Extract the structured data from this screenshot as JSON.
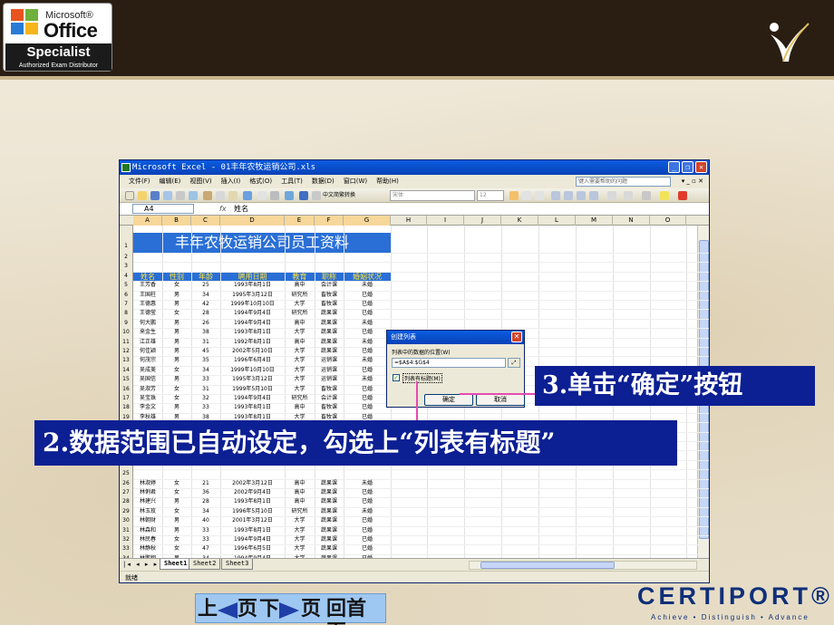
{
  "slide": {
    "logo": {
      "microsoft": "Microsoft®",
      "office": "Office",
      "specialist": "Specialist",
      "authorized": "Authorized Exam Distributor"
    },
    "certiport": {
      "name": "CERTIPORT®",
      "tagline": "Achieve • Distinguish • Advance"
    },
    "nav": {
      "prev": "上",
      "prev_suffix": "页",
      "next": "下",
      "next_suffix": "页",
      "home": "回首页"
    },
    "callout_3": "3.单击“确定”按钮",
    "callout_2": "2.数据范围已自动设定，勾选上“列表有标题”"
  },
  "excel": {
    "title": "Microsoft Excel - 01丰年农牧运销公司.xls",
    "menu": [
      "文件(F)",
      "编辑(E)",
      "视图(V)",
      "插入(I)",
      "格式(O)",
      "工具(T)",
      "数据(D)",
      "窗口(W)",
      "帮助(H)"
    ],
    "help_placeholder": "键入需要帮助的问题",
    "toolbar": {
      "convert_label": "中文简繁转换",
      "font": "宋体",
      "size": "12"
    },
    "name_box": "A4",
    "formula": "姓名",
    "columns": [
      "A",
      "B",
      "C",
      "D",
      "E",
      "F",
      "G",
      "H",
      "I",
      "J",
      "K",
      "L",
      "M",
      "N",
      "O"
    ],
    "row_numbers": [
      "1",
      "2",
      "3",
      "4",
      "5",
      "6",
      "7",
      "8",
      "9",
      "10",
      "11",
      "12",
      "13",
      "14",
      "15",
      "16",
      "17",
      "18",
      "19",
      "20",
      "21",
      "22",
      "23",
      "24",
      "25",
      "26",
      "27",
      "28",
      "29",
      "30",
      "31",
      "32",
      "33",
      "34",
      "35"
    ],
    "banner": "丰年农牧运销公司员工资料",
    "headers": [
      "姓名",
      "性别",
      "年龄",
      "聘用日期",
      "教育",
      "职称",
      "婚姻状况"
    ],
    "rows": [
      [
        "王芳香",
        "女",
        "25",
        "1993年8月1日",
        "高中",
        "会计课",
        "未婚"
      ],
      [
        "王国柱",
        "男",
        "34",
        "1995年3月12日",
        "研究所",
        "畜牧课",
        "已婚"
      ],
      [
        "王德惠",
        "男",
        "42",
        "1999年10月10日",
        "大学",
        "畜牧课",
        "已婚"
      ],
      [
        "王德莹",
        "女",
        "28",
        "1994年9月4日",
        "研究所",
        "蔬果课",
        "已婚"
      ],
      [
        "何大鹏",
        "男",
        "26",
        "1994年9月4日",
        "高中",
        "蔬果课",
        "未婚"
      ],
      [
        "来金生",
        "男",
        "38",
        "1993年8月1日",
        "大学",
        "蔬果课",
        "已婚"
      ],
      [
        "江正雄",
        "男",
        "31",
        "1992年8月1日",
        "高中",
        "蔬果课",
        "未婚"
      ],
      [
        "何佳颖",
        "男",
        "45",
        "2002年5月10日",
        "大学",
        "蔬果课",
        "已婚"
      ],
      [
        "何茂宗",
        "男",
        "35",
        "1996年6月4日",
        "大学",
        "运销课",
        "未婚"
      ],
      [
        "吴成美",
        "女",
        "34",
        "1999年10月10日",
        "大学",
        "运销课",
        "已婚"
      ],
      [
        "吴国信",
        "男",
        "33",
        "1995年3月12日",
        "大学",
        "运销课",
        "未婚"
      ],
      [
        "吴淑芳",
        "女",
        "31",
        "1999年5月10日",
        "大学",
        "畜牧课",
        "已婚"
      ],
      [
        "吴宝珠",
        "女",
        "32",
        "1994年9月4日",
        "研究所",
        "会计课",
        "已婚"
      ],
      [
        "李金文",
        "男",
        "33",
        "1993年8月1日",
        "高中",
        "畜牧课",
        "已婚"
      ],
      [
        "李秋雄",
        "男",
        "38",
        "1993年8月1日",
        "大学",
        "畜牧课",
        "已婚"
      ],
      [
        "李进禄",
        "男",
        "44",
        "1990年8月4日",
        "大学",
        "畜牧课",
        "已婚"
      ]
    ],
    "rows_lower_start": 26,
    "rows_lower": [
      [
        "林淑婷",
        "女",
        "21",
        "2002年3月12日",
        "高中",
        "蔬果课",
        "未婚"
      ],
      [
        "林俐君",
        "女",
        "36",
        "2002年9月4日",
        "高中",
        "蔬果课",
        "已婚"
      ],
      [
        "林建兴",
        "男",
        "28",
        "1993年8月1日",
        "高中",
        "蔬果课",
        "已婚"
      ],
      [
        "林玉玫",
        "女",
        "34",
        "1996年5月10日",
        "研究所",
        "蔬果课",
        "未婚"
      ],
      [
        "林朝财",
        "男",
        "40",
        "2001年3月12日",
        "大学",
        "蔬果课",
        "已婚"
      ],
      [
        "林森和",
        "男",
        "33",
        "1993年8月1日",
        "大学",
        "蔬果课",
        "已婚"
      ],
      [
        "林民春",
        "女",
        "33",
        "1994年9月4日",
        "大学",
        "蔬果课",
        "已婚"
      ],
      [
        "林静秋",
        "女",
        "47",
        "1996年6月5日",
        "大学",
        "蔬果课",
        "已婚"
      ],
      [
        "林鹏翔",
        "男",
        "34",
        "1994年9月4日",
        "大学",
        "蔬果课",
        "已婚"
      ],
      [
        "邱嘉惠",
        "女",
        "47",
        "1994年9月4日",
        "大学",
        "蔬果课",
        "已婚"
      ]
    ],
    "sheet_tabs": [
      "Sheet1",
      "Sheet2",
      "Sheet3"
    ],
    "status": "就绪"
  },
  "dialog": {
    "title": "创建列表",
    "label": "列表中的数据的位置(W)",
    "range": "=$A$4:$G$4",
    "checkbox_label": "列表有标题(M)",
    "checked": true,
    "ok": "确定",
    "cancel": "取消"
  }
}
